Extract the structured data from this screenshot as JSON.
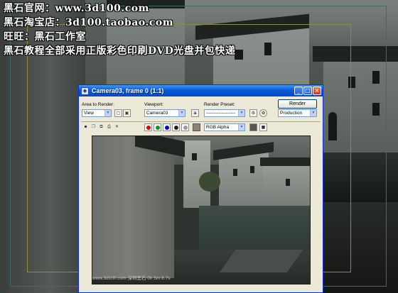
{
  "watermark": {
    "line1": "黑石官网：www.3d100.com",
    "line2": "黑石淘宝店：3d100.taobao.com",
    "line3": "旺旺：黑石工作室",
    "line4": "黑石教程全部采用正版彩色印刷DVD光盘并包快递"
  },
  "window": {
    "title": "Camera03, frame 0 (1:1)",
    "minimize": "_",
    "maximize": "□",
    "close": "×"
  },
  "controls": {
    "area_label": "Area to Render:",
    "area_value": "View",
    "viewport_label": "Viewport:",
    "viewport_value": "Camera03",
    "preset_label": "Render Preset:",
    "preset_value": "-------------------",
    "render_button": "Render",
    "mode_value": "Production",
    "channel_value": "RGB Alpha",
    "lock_icon_glyph": "a",
    "clear_glyph": "✕",
    "print_glyph": "⎙"
  },
  "colors": {
    "titlebar": "#0a5bd6",
    "red_channel": "#e00000",
    "green_channel": "#00a000",
    "blue_channel": "#0000e0",
    "alpha_channel": "#ffffff",
    "swatch": "#8b8378"
  },
  "render": {
    "footer": "www.3d100.com    深圳黑石    0h 5m 8.7s"
  }
}
